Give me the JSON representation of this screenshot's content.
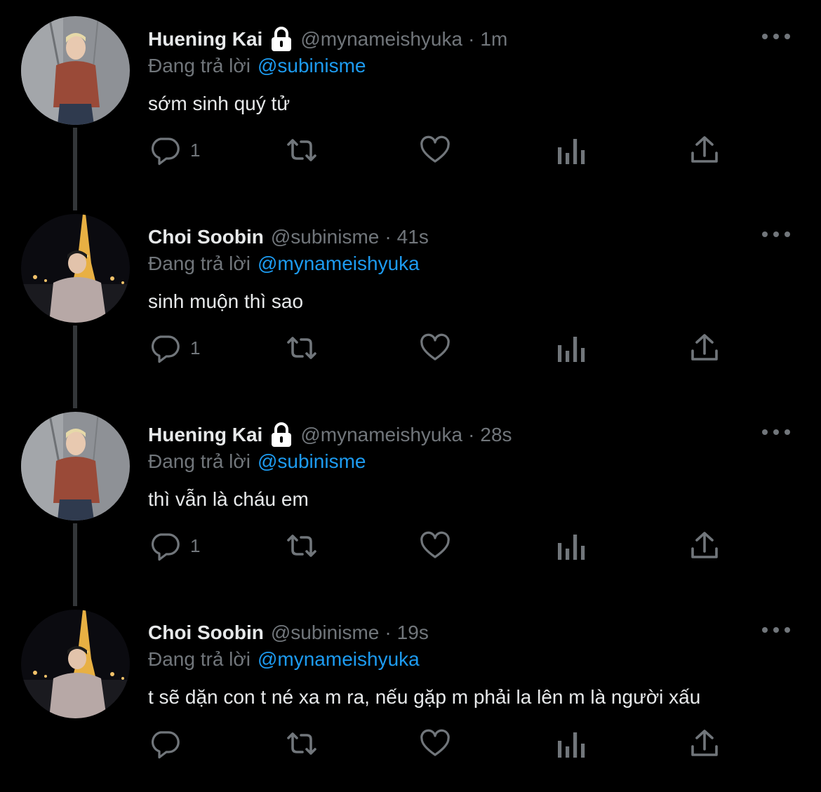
{
  "thread": {
    "tweets": [
      {
        "name": "Huening Kai",
        "locked": true,
        "handle": "@mynameishyuka",
        "separator": "·",
        "time": "1m",
        "replying_label": "Đang trả lời",
        "replying_to": "@subinisme",
        "text": "sớm sinh quý tử",
        "reply_count": "1",
        "avatar": "huening-kai"
      },
      {
        "name": "Choi Soobin",
        "locked": false,
        "handle": "@subinisme",
        "separator": "·",
        "time": "41s",
        "replying_label": "Đang trả lời",
        "replying_to": "@mynameishyuka",
        "text": "sinh muộn thì sao",
        "reply_count": "1",
        "avatar": "choi-soobin"
      },
      {
        "name": "Huening Kai",
        "locked": true,
        "handle": "@mynameishyuka",
        "separator": "·",
        "time": "28s",
        "replying_label": "Đang trả lời",
        "replying_to": "@subinisme",
        "text": "thì vẫn là cháu em",
        "reply_count": "1",
        "avatar": "huening-kai"
      },
      {
        "name": "Choi Soobin",
        "locked": false,
        "handle": "@subinisme",
        "separator": "·",
        "time": "19s",
        "replying_label": "Đang trả lời",
        "replying_to": "@mynameishyuka",
        "text": "t sẽ dặn con t né xa m ra, nếu gặp m phải la lên m là người xấu",
        "reply_count": "",
        "avatar": "choi-soobin"
      }
    ]
  },
  "icons": {
    "more": "more-horizontal-icon",
    "reply": "reply-icon",
    "retweet": "retweet-icon",
    "like": "heart-icon",
    "views": "analytics-icon",
    "share": "share-icon",
    "lock": "lock-icon"
  },
  "colors": {
    "background": "#000000",
    "text": "#e7e9ea",
    "secondary": "#71767b",
    "accent": "#1d9bf0",
    "thread_line": "#333639"
  }
}
